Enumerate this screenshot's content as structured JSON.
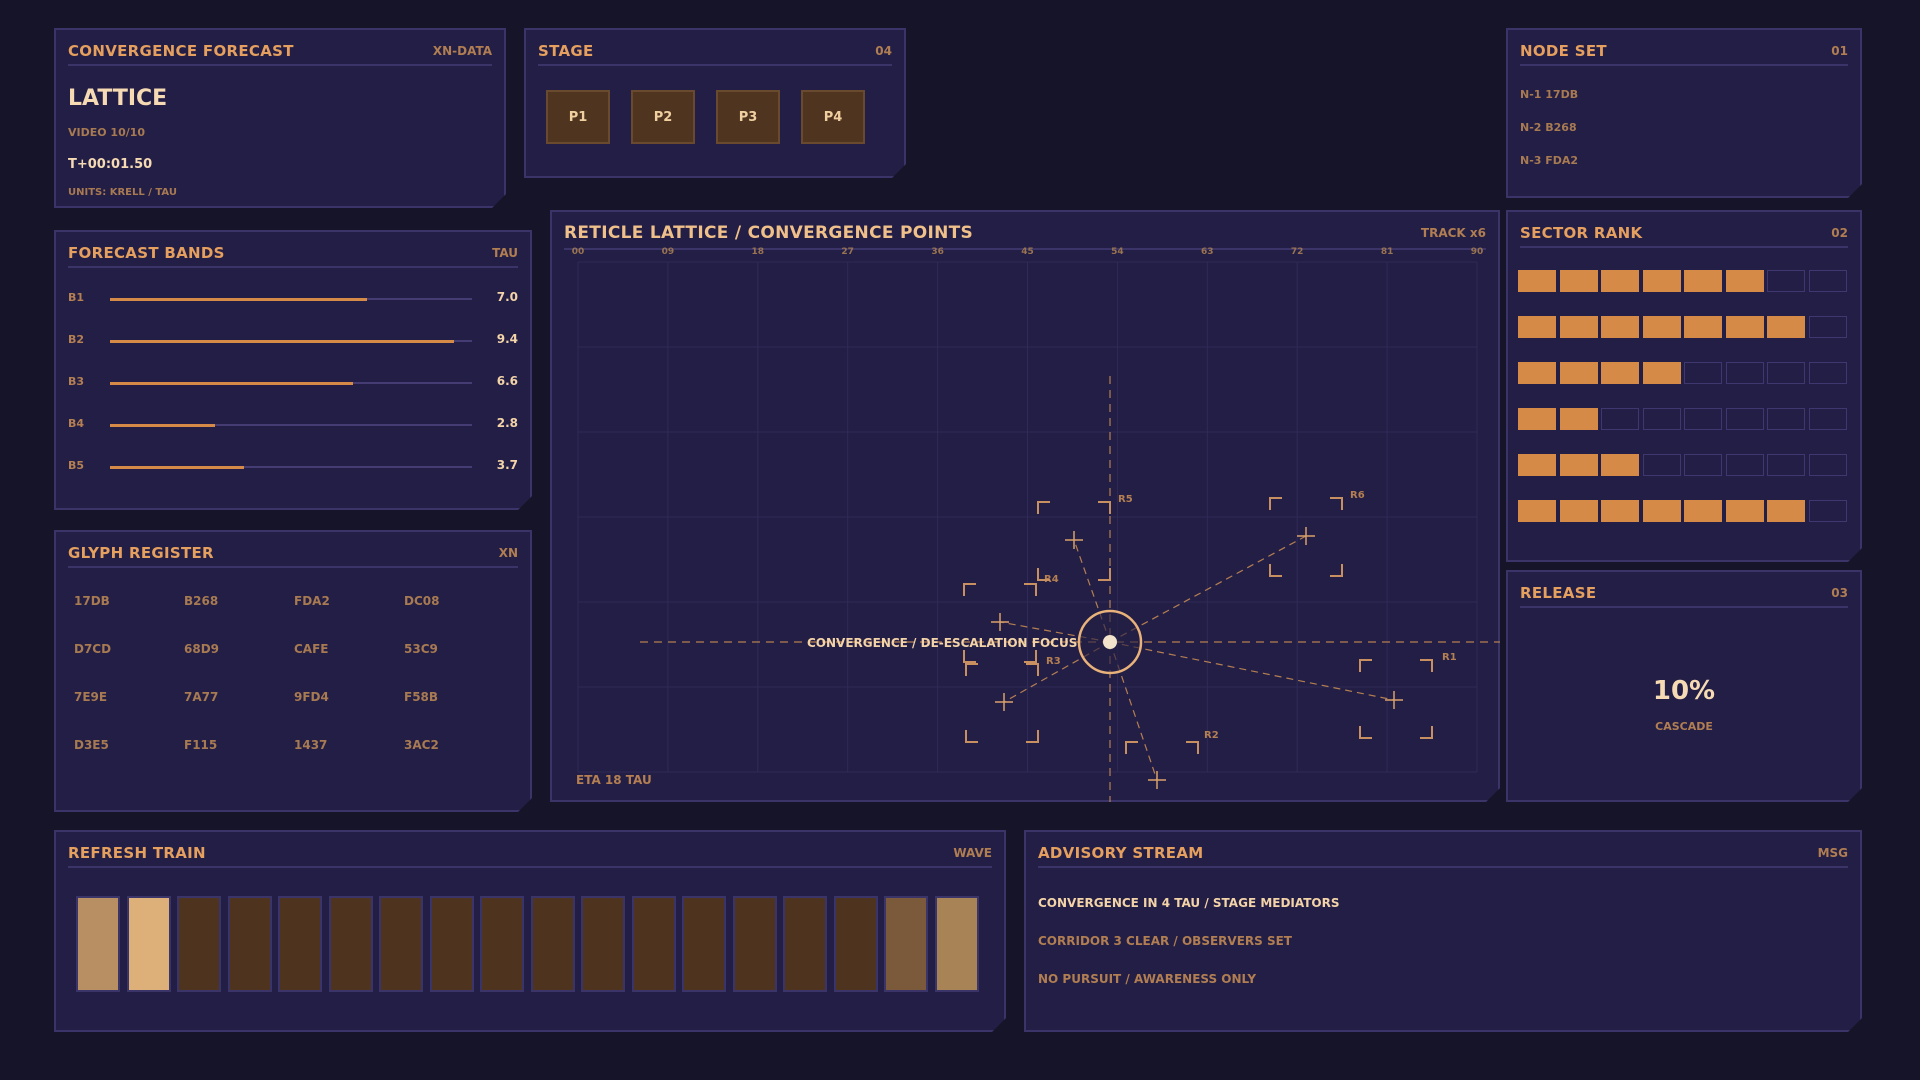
{
  "forecast": {
    "title": "CONVERGENCE FORECAST",
    "tag": "XN-DATA",
    "name": "LATTICE",
    "video": "VIDEO 10/10",
    "time": "T+00:01.50",
    "units": "UNITS: KRELL / TAU"
  },
  "stage": {
    "title": "STAGE",
    "tag": "04",
    "buttons": [
      "P1",
      "P2",
      "P3",
      "P4"
    ]
  },
  "nodeset": {
    "title": "NODE SET",
    "tag": "01",
    "items": [
      "N-1  17DB",
      "N-2  B268",
      "N-3  FDA2"
    ]
  },
  "bands": {
    "title": "FORECAST BANDS",
    "tag": "TAU",
    "items": [
      {
        "label": "B1",
        "value": "7.0",
        "level": 0.71
      },
      {
        "label": "B2",
        "value": "9.4",
        "level": 0.95
      },
      {
        "label": "B3",
        "value": "6.6",
        "level": 0.67
      },
      {
        "label": "B4",
        "value": "2.8",
        "level": 0.29
      },
      {
        "label": "B5",
        "value": "3.7",
        "level": 0.37
      }
    ]
  },
  "glyphs": {
    "title": "GLYPH REGISTER",
    "tag": "XN",
    "items": [
      "17DB",
      "B268",
      "FDA2",
      "DC08",
      "D7CD",
      "68D9",
      "CAFE",
      "53C9",
      "7E9E",
      "7A77",
      "9FD4",
      "F58B",
      "D3E5",
      "F115",
      "1437",
      "3AC2"
    ]
  },
  "main": {
    "title": "RETICLE LATTICE / CONVERGENCE POINTS",
    "tag": "TRACK x6",
    "ticks": [
      "00",
      "09",
      "18",
      "27",
      "36",
      "45",
      "54",
      "63",
      "72",
      "81",
      "90"
    ],
    "eta": "ETA 18 TAU",
    "focus_label": "CONVERGENCE / DE-ESCALATION FOCUS",
    "reticles": [
      "R1",
      "R2",
      "R3",
      "R4",
      "R5",
      "R6"
    ]
  },
  "sector": {
    "title": "SECTOR RANK",
    "tag": "02",
    "rows": [
      6,
      7,
      4,
      2,
      3,
      7
    ],
    "cells_per_row": 8
  },
  "release": {
    "title": "RELEASE",
    "tag": "03",
    "value": "10%",
    "label": "CASCADE"
  },
  "train": {
    "title": "REFRESH TRAIN",
    "tag": "WAVE",
    "colors": [
      "#b78f62",
      "#ddb07a",
      "#4e341f",
      "#4e341f",
      "#4e341f",
      "#4e341f",
      "#4e341f",
      "#4e341f",
      "#4e341f",
      "#4e341f",
      "#4e341f",
      "#4e341f",
      "#4e341f",
      "#4e341f",
      "#4e341f",
      "#4e341f",
      "#7a5a3b",
      "#a78356"
    ]
  },
  "advisory": {
    "title": "ADVISORY STREAM",
    "tag": "MSG",
    "lines": [
      "CONVERGENCE IN 4 TAU / STAGE MEDIATORS",
      "CORRIDOR 3 CLEAR / OBSERVERS SET",
      "NO PURSUIT / AWARENESS ONLY"
    ]
  },
  "colors": {
    "background": "#161429",
    "panel": "#231e45",
    "border": "#3a3468",
    "accent": "#d58a47",
    "text_bright": "#f3d3a8"
  }
}
